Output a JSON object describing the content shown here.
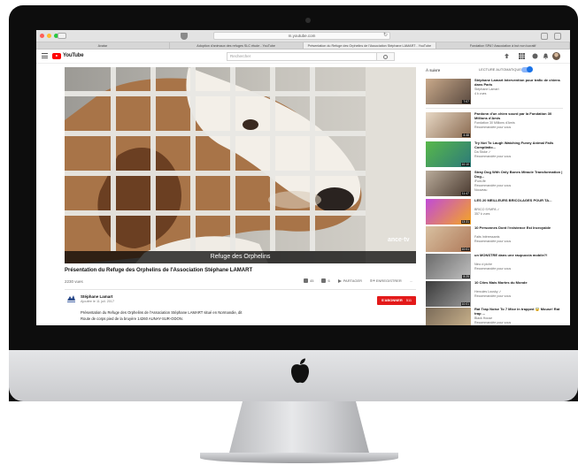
{
  "browser": {
    "url": "m.youtube.com",
    "tabs": [
      {
        "label": "Avatar"
      },
      {
        "label": "Adoption d'animaux des refuges SLC étude - YouTube"
      },
      {
        "label": "Présentation du Refuge des Orphelins de l'Association Stéphane LAMART - YouTube"
      },
      {
        "label": "Fondation SPA? Association à but non lucratif"
      }
    ]
  },
  "youtube": {
    "logo_text": "YouTube",
    "search_placeholder": "Rechercher"
  },
  "video": {
    "caption": "Refuge des Orphelins",
    "watermark": "ance·tv",
    "title": "Présentation du Refuge des Orphelins de l'Association Stéphane LAMART",
    "views": "2230 vues",
    "likes": "45",
    "dislikes": "6",
    "share_label": "PARTAGER",
    "save_label": "ENREGISTRER",
    "more_label": "...",
    "channel": "Stéphane Lamart",
    "published": "Ajoutée le 11 juil. 2017",
    "subscribe_label": "S'ABONNER",
    "subscriber_count": "511",
    "description_lines": [
      "Présentation du Refuge des Orphelins de l'Association Stéphane LAMART situé en Normandie, dit",
      "Route de corps pied de la bruyère 14260 AUNAY-SUR-ODON."
    ]
  },
  "sidebar": {
    "up_next_label": "À suivre",
    "autoplay_label": "LECTURE AUTOMATIQUE",
    "autoplay_on": true,
    "items": [
      {
        "title": "Stéphane Lamart Intervention pour trafic de chiens dans Paris",
        "channel": "Stéphane Lamart",
        "meta": "4 k vues",
        "duration": "7:07",
        "colors": [
          "#c9a98a",
          "#5a4a40"
        ]
      },
      {
        "title": "Pardonn d'un chien sourd par la Fondation 30 Millions d'Amis",
        "channel": "Fondation 30 Millions d'Amis",
        "meta": "Recommandée pour vous",
        "duration": "4:48",
        "colors": [
          "#e7d8c5",
          "#8a6a50"
        ]
      },
      {
        "title": "Try Not To Laugh Watching Funny Animal Fails Compilatio...",
        "channel": "Da Stoke ✓",
        "meta": "Recommandée pour vous",
        "duration": "10:10",
        "colors": [
          "#58b84a",
          "#2d7a7a"
        ]
      },
      {
        "title": "Stray Dog With Only Bones Miracle Transformation | Dog...",
        "channel": "iFunLife",
        "meta": "Recommandée pour vous",
        "extra": "Nouveau",
        "duration": "11:47",
        "colors": [
          "#b9ab9a",
          "#4a3a30"
        ]
      },
      {
        "title": "LES 20 MEILLEURS BRICOLAGES POUR TA...",
        "channel": "BRICO SYMPA ✓",
        "meta": "357 k vues",
        "duration": "13:31",
        "colors": [
          "#c04ad8",
          "#f5a623"
        ]
      },
      {
        "title": "10 Personnes Dont l'existence Est Incroyable",
        "channel": "Faits Intéressants",
        "meta": "Recommandée pour vous",
        "duration": "10:01",
        "colors": [
          "#d8c0a0",
          "#b07a5a"
        ]
      },
      {
        "title": "un MONSTRE dans une raupuccia mobile?!",
        "channel": "Nino d piche",
        "meta": "Recommandée pour vous",
        "duration": "8:25",
        "colors": [
          "#6a6a6a",
          "#c0c0c0"
        ]
      },
      {
        "title": "10 Cites Mais Mortes du Monde",
        "channel": "Hercules Lousky ✓",
        "meta": "Recommandée pour vous",
        "duration": "10:01",
        "colors": [
          "#3a3a3a",
          "#9a9a9a"
        ]
      },
      {
        "title": "Rat Trap Noise To 7 Mice in trapped 😱 Mouse! Rat trap ...",
        "channel": "Black House",
        "meta": "Recommandée pour vous",
        "duration": "",
        "colors": [
          "#7a6a58",
          "#d0b890"
        ]
      }
    ]
  }
}
